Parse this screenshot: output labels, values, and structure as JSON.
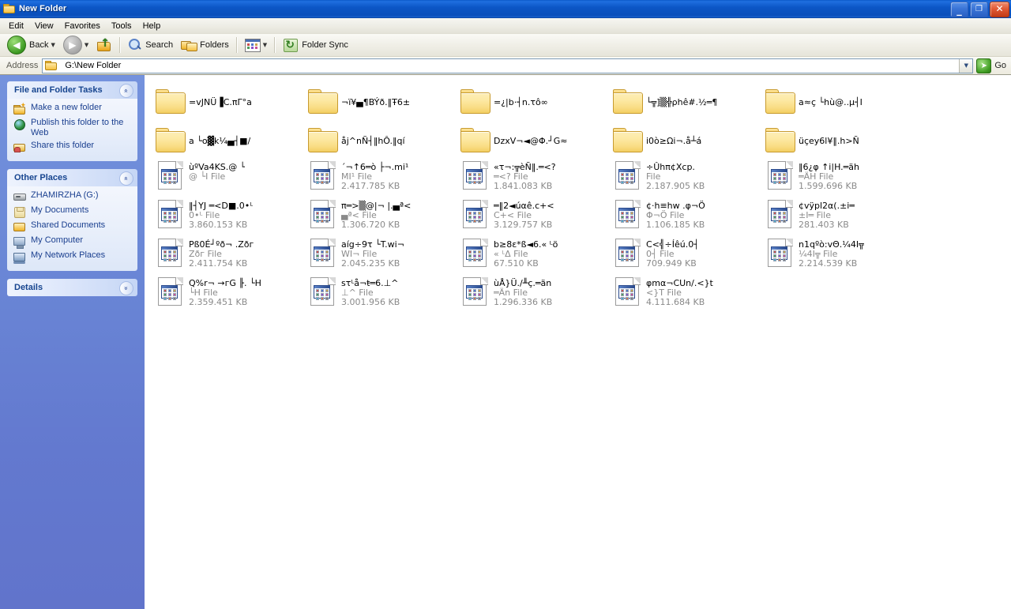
{
  "window": {
    "title": "New Folder",
    "icon": "folder-icon",
    "controls": {
      "minimize": "_",
      "restore": "❐",
      "close": "✕"
    }
  },
  "menu": {
    "items": [
      "Edit",
      "View",
      "Favorites",
      "Tools",
      "Help"
    ]
  },
  "toolbar": {
    "back_label": "Back",
    "back_icon": "back-arrow-icon",
    "forward_icon": "forward-arrow-icon",
    "up_icon": "up-folder-icon",
    "search_label": "Search",
    "search_icon": "magnifier-icon",
    "folders_label": "Folders",
    "folders_icon": "folders-icon",
    "views_icon": "views-icon",
    "folder_sync_label": "Folder Sync",
    "folder_sync_icon": "folder-sync-icon",
    "dropdown_arrow": "▼"
  },
  "address": {
    "label": "Address",
    "icon": "folder-icon",
    "value": "G:\\New Folder",
    "dropdown_arrow": "▼",
    "go_label": "Go",
    "go_icon": "go-arrow-icon"
  },
  "sidebar": {
    "panels": [
      {
        "title": "File and Folder Tasks",
        "collapse_glyph": "»",
        "items": [
          {
            "label": "Make a new folder",
            "icon": "new-folder-icon",
            "name": "make-a-new-folder"
          },
          {
            "label": "Publish this folder to the Web",
            "icon": "globe-icon",
            "name": "publish-this-folder-to-the-web"
          },
          {
            "label": "Share this folder",
            "icon": "shared-folder-icon",
            "name": "share-this-folder"
          }
        ]
      },
      {
        "title": "Other Places",
        "collapse_glyph": "»",
        "items": [
          {
            "label": "ZHAMIRZHA (G:)",
            "icon": "drive-icon",
            "name": "zhamirzha-g-drive"
          },
          {
            "label": "My Documents",
            "icon": "my-documents-icon",
            "name": "my-documents"
          },
          {
            "label": "Shared Documents",
            "icon": "shared-documents-icon",
            "name": "shared-documents"
          },
          {
            "label": "My Computer",
            "icon": "my-computer-icon",
            "name": "my-computer"
          },
          {
            "label": "My Network Places",
            "icon": "my-network-places-icon",
            "name": "my-network-places"
          }
        ]
      },
      {
        "title": "Details",
        "collapse_glyph": "«",
        "items": []
      }
    ]
  },
  "files": {
    "entries": [
      {
        "kind": "folder",
        "name": "=vJNÜ▐C.πΓ°a"
      },
      {
        "kind": "folder",
        "name": "¬ï¥▄¶BÝð.‖Ŧ6±"
      },
      {
        "kind": "folder",
        "name": "=¿|b·┤n.τô∞"
      },
      {
        "kind": "folder",
        "name": "└╦]▒╬ρhê#.½═¶"
      },
      {
        "kind": "folder",
        "name": "a≈ç └hù@..µ┤I"
      },
      {
        "kind": "folder",
        "name": "a └o▓k¼▄┤■/"
      },
      {
        "kind": "folder",
        "name": "åj^nÑ┤‖hÔ.‖qí"
      },
      {
        "kind": "folder",
        "name": "DzxV¬◄@Φ.┘G≈"
      },
      {
        "kind": "folder",
        "name": "i0ò≥Ωi¬.å┴á"
      },
      {
        "kind": "folder",
        "name": "üçey6l¥‖.h>Ñ"
      },
      {
        "kind": "file",
        "name": "ùºVa4KS.@ └",
        "type": "@ └I File",
        "size": ""
      },
      {
        "kind": "file",
        "name": "´¬↑6═ò ├¬.mi¹",
        "type": "MI¹ File",
        "size": "2.417.785 KB"
      },
      {
        "kind": "file",
        "name": "«τ¬:╦èÑ‖.═<?",
        "type": "═<? File",
        "size": "1.841.083 KB"
      },
      {
        "kind": "file",
        "name": "÷Ûhπ¢Xcp.",
        "type": "File",
        "size": "2.187.905 KB"
      },
      {
        "kind": "file",
        "name": "‖6¿φ ↑i|H.═äh",
        "type": "═ÄH File",
        "size": "1.599.696 KB"
      },
      {
        "kind": "file",
        "name": "‖┤YJ ═<D■.0•ᴸ",
        "type": "0•ᴸ File",
        "size": "3.860.153 KB"
      },
      {
        "kind": "file",
        "name": "π═>▒@|¬ |.▄ª<",
        "type": "▄ª< File",
        "size": "1.306.720 KB"
      },
      {
        "kind": "file",
        "name": "═‖2◄úαê.c+<",
        "type": "C+< File",
        "size": "3.129.757 KB"
      },
      {
        "kind": "file",
        "name": "¢·h≡hw .φ¬Ö",
        "type": "Φ¬Ö File",
        "size": "1.106.185 KB"
      },
      {
        "kind": "file",
        "name": "¢vÿpl2α(.±i═",
        "type": "±I═ File",
        "size": "281.403 KB"
      },
      {
        "kind": "file",
        "name": "Pß0É┘ºð¬ .Zðг",
        "type": "Zðг File",
        "size": "2.411.754 KB"
      },
      {
        "kind": "file",
        "name": "aíg÷9τ └T.wi¬",
        "type": "WI¬ File",
        "size": "2.045.235 KB"
      },
      {
        "kind": "file",
        "name": "b≥8ε*ß◄6.« ᴸö",
        "type": "« ᴸΔ File",
        "size": "67.510 KB"
      },
      {
        "kind": "file",
        "name": "C<╣÷Íêú.0┤",
        "type": "0┤ File",
        "size": "709.949 KB"
      },
      {
        "kind": "file",
        "name": "n1qºò:vΘ.¼4I╦",
        "type": "¼4I╦ File",
        "size": "2.214.539 KB"
      },
      {
        "kind": "file",
        "name": "Q%r¬ →гG ╟. └H",
        "type": "└H File",
        "size": "2.359.451 KB"
      },
      {
        "kind": "file",
        "name": "sτᴸå¬ŧ═6.⊥^",
        "type": "⊥^ File",
        "size": "3.001.956 KB"
      },
      {
        "kind": "file",
        "name": "ùÅ}Ü./╨ç.═än",
        "type": "═Än File",
        "size": "1.296.336 KB"
      },
      {
        "kind": "file",
        "name": "φmα¬CUn/.<}t",
        "type": "<}T File",
        "size": "4.111.684 KB"
      }
    ]
  },
  "colors": {
    "title_blue": "#0c56c6",
    "sidebar_blue": "#6a87d6",
    "panel_header": "#dfe8fb",
    "link_blue": "#1a3f8f",
    "folder_yellow": "#f9dc83",
    "meta_gray": "#8a8a8a"
  }
}
